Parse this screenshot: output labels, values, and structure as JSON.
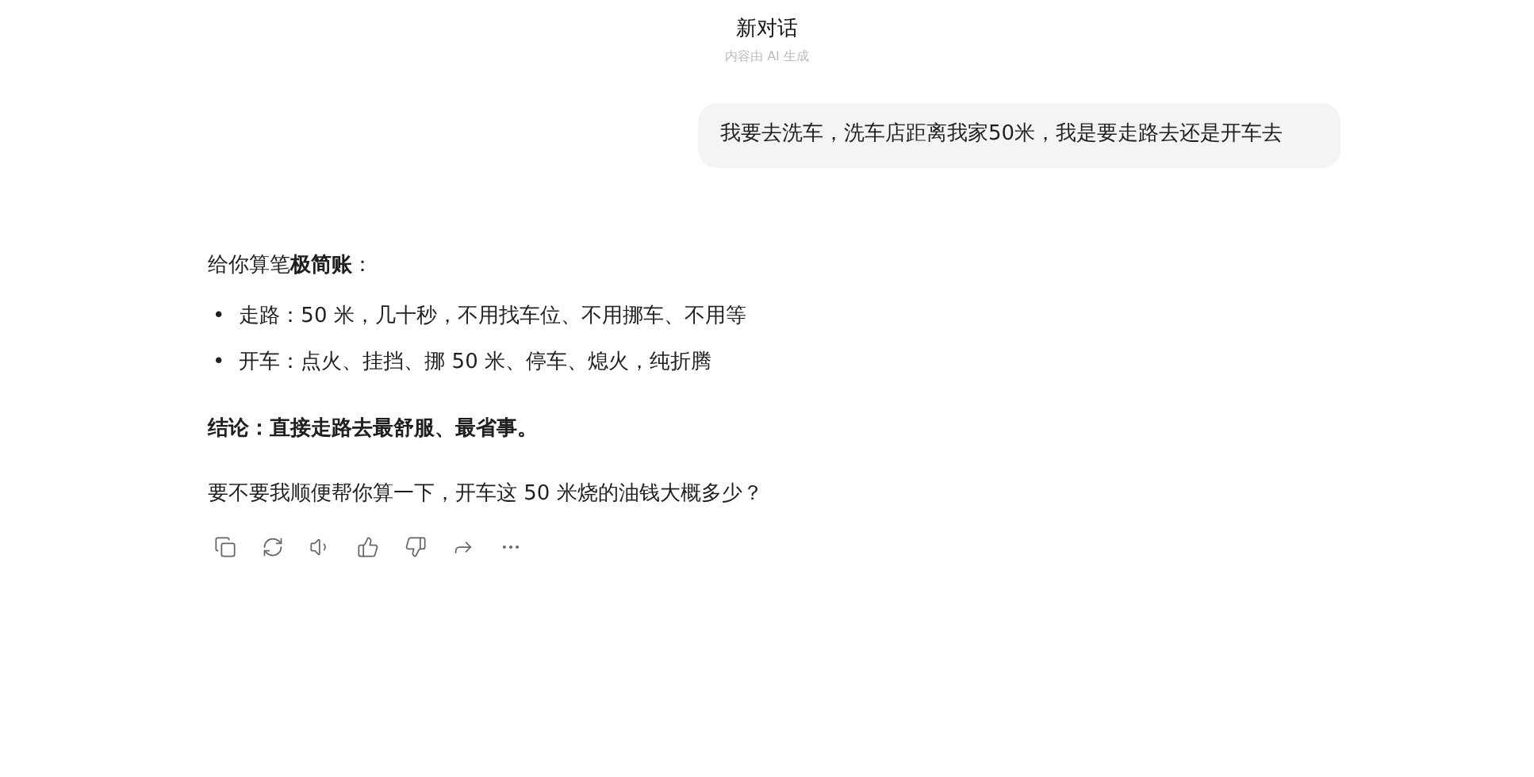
{
  "header": {
    "title": "新对话",
    "subtitle": "内容由 AI 生成"
  },
  "user_message": "我要去洗车，洗车店距离我家50米，我是要走路去还是开车去",
  "reply": {
    "intro": "给你算笔**极简账**：",
    "bullets": [
      {
        "marker": "•",
        "text": "走路：50 米，几十秒，不用找车位、不用挪车、不用等"
      },
      {
        "marker": "•",
        "text": "开车：点火、挂挡、挪 50 米、停车、熄火，纯折腾"
      }
    ],
    "conclusion": "结论：直接走路去最舒服、最省事。",
    "question": "要不要我顺便帮你算一下，开车这 50 米烧的油钱大概多少？"
  }
}
